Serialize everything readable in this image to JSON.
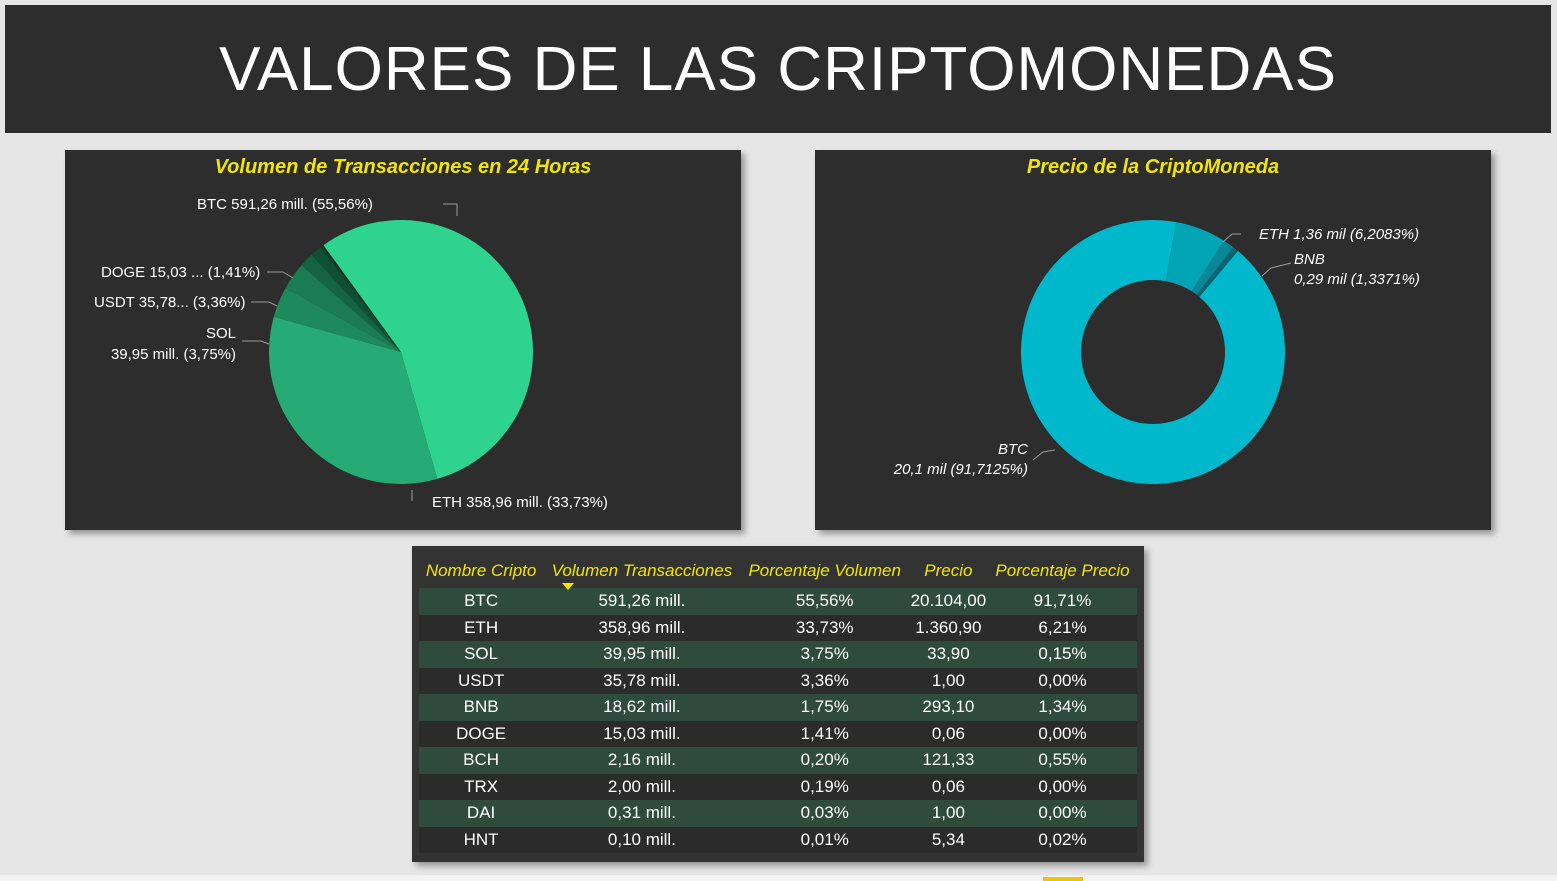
{
  "header": {
    "title": "VALORES DE LAS CRIPTOMONEDAS"
  },
  "pie_card": {
    "title": "Volumen de Transacciones en 24 Horas",
    "labels": {
      "btc": "BTC 591,26 mill. (55,56%)",
      "doge": "DOGE 15,03 ... (1,41%)",
      "usdt": "USDT 35,78... (3,36%)",
      "sol_line1": "SOL",
      "sol_line2": "39,95 mill. (3,75%)",
      "eth": "ETH 358,96 mill. (33,73%)"
    }
  },
  "donut_card": {
    "title": "Precio de la CriptoMoneda",
    "labels": {
      "eth": "ETH 1,36 mil (6,2083%)",
      "bnb_line1": "BNB",
      "bnb_line2": "0,29 mil (1,3371%)",
      "btc_line1": "BTC",
      "btc_line2": "20,1 mil (91,7125%)"
    }
  },
  "chart_data": [
    {
      "type": "pie",
      "title": "Volumen de Transacciones en 24 Horas",
      "categories": [
        "BTC",
        "ETH",
        "SOL",
        "USDT",
        "BNB",
        "DOGE",
        "BCH",
        "TRX",
        "DAI",
        "HNT"
      ],
      "values": [
        591.26,
        358.96,
        39.95,
        35.78,
        18.62,
        15.03,
        2.16,
        2.0,
        0.31,
        0.1
      ],
      "unit": "mill.",
      "colors": [
        "#2dd38e",
        "#25ab73",
        "#1e8a5c",
        "#1b7b52",
        "#146341",
        "#0f4f34",
        "#0c4029",
        "#0a3521",
        "#082c1b",
        "#062416"
      ]
    },
    {
      "type": "pie",
      "title": "Precio de la CriptoMoneda",
      "donut": true,
      "categories": [
        "BTC",
        "ETH",
        "BNB",
        "SOL",
        "BCH",
        "HNT",
        "USDT",
        "DAI",
        "DOGE",
        "TRX"
      ],
      "values": [
        20104.0,
        1360.9,
        293.1,
        33.9,
        121.33,
        5.34,
        1.0,
        1.0,
        0.06,
        0.06
      ],
      "colors": [
        "#00b8cc",
        "#00a4b5",
        "#0a8797",
        "#0b7382",
        "#0d6470",
        "#0d5761",
        "#0e4d56",
        "#0e454d",
        "#0e3e45",
        "#0e383f"
      ]
    },
    {
      "type": "table",
      "columns": [
        "Nombre Cripto",
        "Volumen Transacciones",
        "Porcentaje Volumen",
        "Precio",
        "Porcentaje Precio"
      ],
      "rows": [
        [
          "BTC",
          "591,26 mill.",
          "55,56%",
          "20.104,00",
          "91,71%"
        ],
        [
          "ETH",
          "358,96 mill.",
          "33,73%",
          "1.360,90",
          "6,21%"
        ],
        [
          "SOL",
          "39,95 mill.",
          "3,75%",
          "33,90",
          "0,15%"
        ],
        [
          "USDT",
          "35,78 mill.",
          "3,36%",
          "1,00",
          "0,00%"
        ],
        [
          "BNB",
          "18,62 mill.",
          "1,75%",
          "293,10",
          "1,34%"
        ],
        [
          "DOGE",
          "15,03 mill.",
          "1,41%",
          "0,06",
          "0,00%"
        ],
        [
          "BCH",
          "2,16 mill.",
          "0,20%",
          "121,33",
          "0,55%"
        ],
        [
          "TRX",
          "2,00 mill.",
          "0,19%",
          "0,06",
          "0,00%"
        ],
        [
          "DAI",
          "0,31 mill.",
          "0,03%",
          "1,00",
          "0,00%"
        ],
        [
          "HNT",
          "0,10 mill.",
          "0,01%",
          "5,34",
          "0,02%"
        ]
      ],
      "sorted_column": "Volumen Transacciones",
      "sort_direction": "descending"
    }
  ]
}
